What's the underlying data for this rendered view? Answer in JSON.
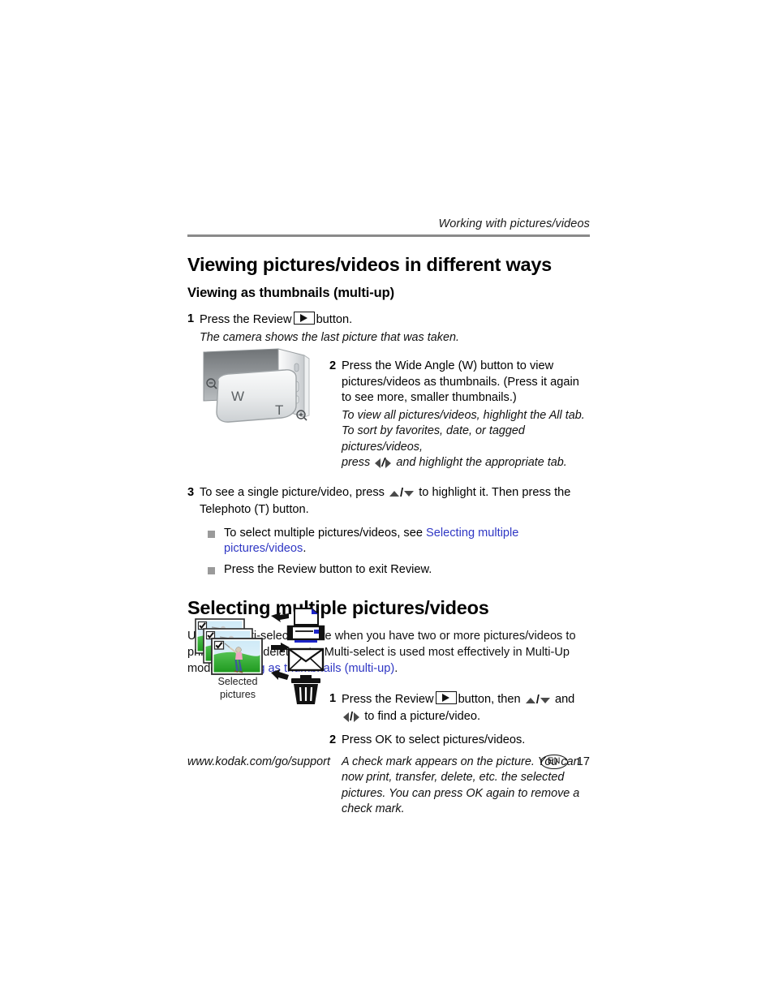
{
  "header": {
    "running_head": "Working with pictures/videos"
  },
  "section1": {
    "title": "Viewing pictures/videos in different ways",
    "subtitle": "Viewing as thumbnails (multi-up)",
    "step1": {
      "num": "1",
      "text_before_icon": "Press the Review",
      "icon": "review-button-icon",
      "text_after_icon": "button.",
      "note": "The camera shows the last picture that was taken."
    },
    "step2": {
      "num": "2",
      "text": "Press the Wide Angle (W) button to view pictures/videos as thumbnails. (Press it again to see more, smaller thumbnails.)",
      "note_line1": "To view all pictures/videos, highlight the All tab.",
      "note_line2": "To sort by favorites, date, or tagged pictures/videos,",
      "note_line3_before": "press",
      "note_line3_after": "and highlight the appropriate tab."
    },
    "step3": {
      "num": "3",
      "text_before_arrows": "To see a single picture/video, press",
      "text_after_arrows": "to highlight it. Then press the Telephoto (T) button."
    },
    "bullets": [
      {
        "text_before_link": "To select multiple pictures/videos, see ",
        "link": "Selecting multiple pictures/videos",
        "text_after_link": "."
      },
      {
        "text_before_link": "Press the Review button to exit Review.",
        "link": "",
        "text_after_link": ""
      }
    ],
    "camera_figure": {
      "label_wide": "W",
      "label_tele": "T",
      "zoom_out_icon": "magnifier-minus-icon",
      "zoom_in_icon": "magnifier-plus-icon"
    }
  },
  "section2": {
    "title": "Selecting multiple pictures/videos",
    "intro_before_link": "Use the multi-select feature when you have two or more pictures/videos to print, transfer, delete, etc. Multi-select is used most effectively in Multi-Up mode, ",
    "intro_link": "Viewing as thumbnails (multi-up)",
    "intro_after_link": ".",
    "step1": {
      "num": "1",
      "text_a": "Press the Review",
      "icon": "review-button-icon",
      "text_b": "button, then",
      "text_c": "and",
      "text_d": "to find a picture/video."
    },
    "step2": {
      "num": "2",
      "text": "Press OK to select pictures/videos.",
      "note": "A check mark appears on the picture. You can now print, transfer, delete, etc. the selected pictures. You can press OK again to remove a check mark."
    },
    "figure": {
      "caption_line1": "Selected",
      "caption_line2": "pictures",
      "thumbnail_count": 3,
      "check_icon": "check-mark-icon",
      "arrow_icon": "arrow-right-icon",
      "actions": [
        {
          "icon": "printer-icon"
        },
        {
          "icon": "envelope-icon"
        },
        {
          "icon": "trash-icon"
        }
      ]
    }
  },
  "footer": {
    "url": "www.kodak.com/go/support",
    "language": "EN",
    "page_number": "17"
  },
  "colors": {
    "link": "#2f37c4",
    "rule": "#8a8a8a",
    "bullet": "#9a9a9a",
    "printer_accent": "#1c24c8",
    "photo_sky": "#bfe4f5",
    "photo_grass": "#33b133"
  }
}
